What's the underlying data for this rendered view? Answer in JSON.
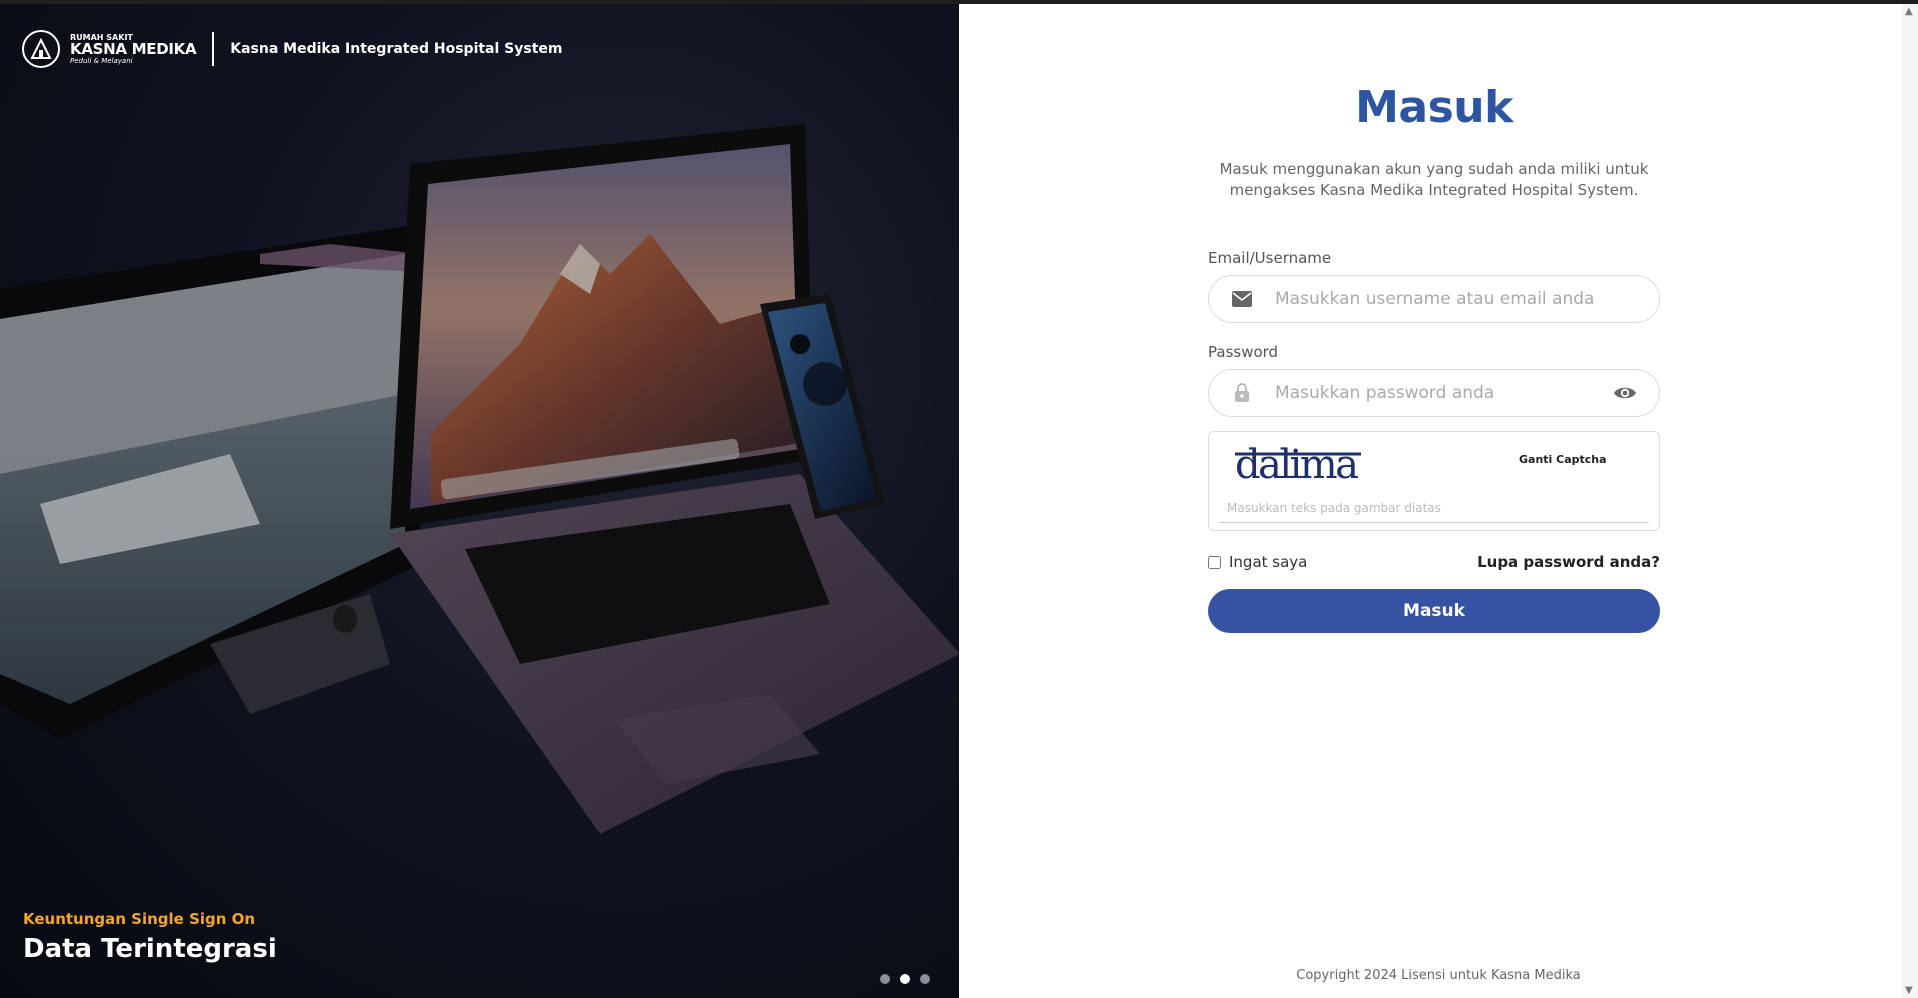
{
  "brand": {
    "logo_small": "RUMAH SAKIT",
    "logo_big": "KASNA MEDIKA",
    "logo_tagline": "Peduli & Melayani",
    "system_title": "Kasna Medika Integrated Hospital System"
  },
  "slide": {
    "subtitle": "Keuntungan Single Sign On",
    "title": "Data Terintegrasi",
    "dots_total": 3,
    "active_index": 1
  },
  "form": {
    "title": "Masuk",
    "description": "Masuk menggunakan akun yang sudah anda miliki untuk mengakses Kasna Medika Integrated Hospital System.",
    "email_label": "Email/Username",
    "email_placeholder": "Masukkan username atau email anda",
    "password_label": "Password",
    "password_placeholder": "Masukkan password anda",
    "captcha_text": "dalima",
    "captcha_change": "Ganti Captcha",
    "captcha_placeholder": "Masukkan teks pada gambar diatas",
    "remember_label": "Ingat saya",
    "forgot_label": "Lupa password anda?",
    "submit_label": "Masuk"
  },
  "footer": {
    "copyright": "Copyright 2024 Lisensi untuk Kasna Medika"
  },
  "colors": {
    "primary": "#3552a3",
    "title": "#2d55a3",
    "accent": "#f5a623"
  },
  "icons": {
    "email": "envelope-icon",
    "password": "lock-icon",
    "toggle": "eye-icon"
  }
}
